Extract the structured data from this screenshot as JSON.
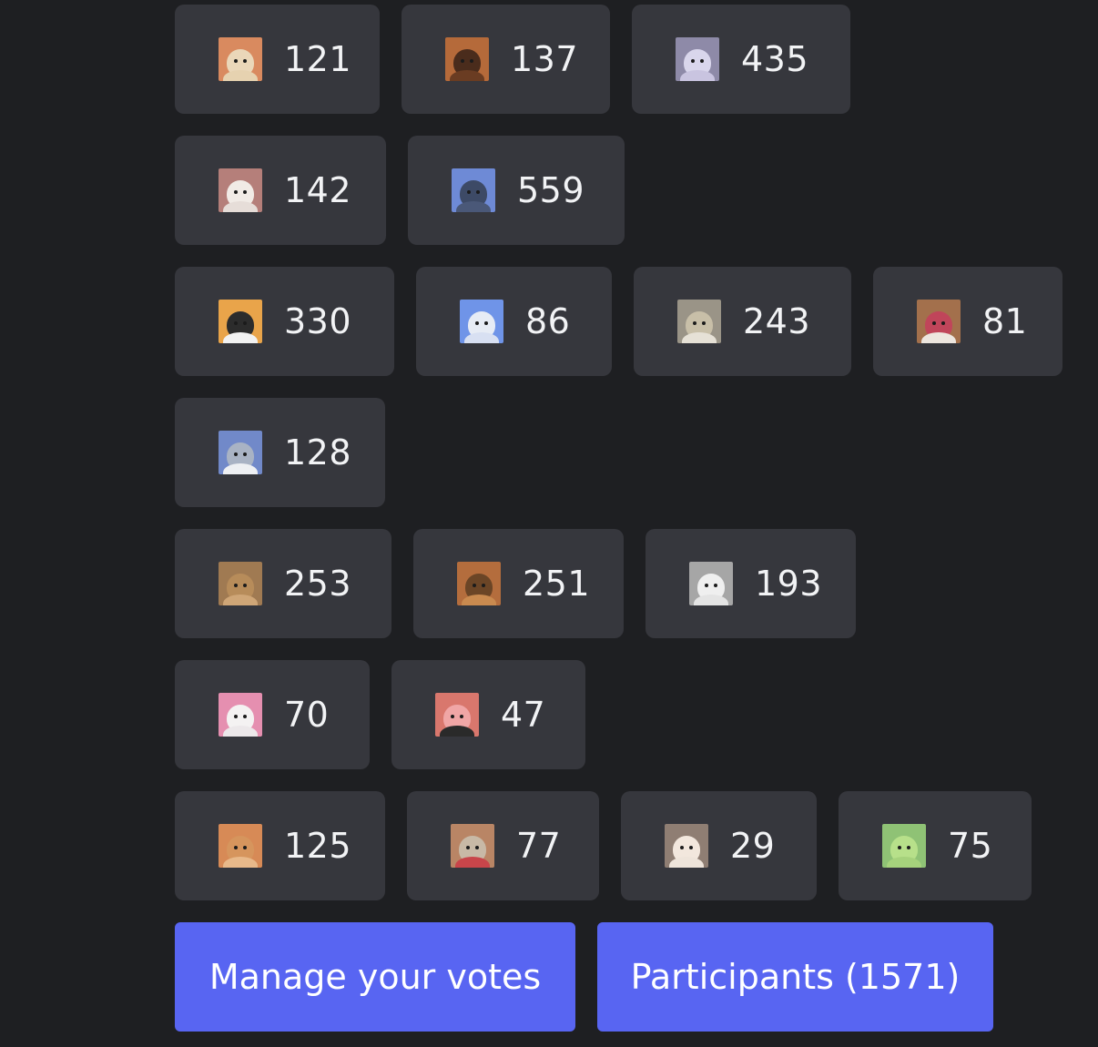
{
  "poll": {
    "answers": [
      {
        "icon": "french-bulldog-avatar-icon",
        "votes": "121",
        "bg": "#d98a5f",
        "head": "#ead7b9",
        "body": "#e6d2b0"
      },
      {
        "icon": "rottweiler-avatar-icon",
        "votes": "137",
        "bg": "#b56a3a",
        "head": "#4a2c1c",
        "body": "#6a3c22"
      },
      {
        "icon": "dolphin-avatar-icon",
        "votes": "435",
        "bg": "#8e8aa8",
        "head": "#d9d6ec",
        "body": "#c9c4e0"
      },
      {
        "icon": "alpaca-avatar-icon",
        "votes": "142",
        "bg": "#b57f7a",
        "head": "#f1ebe6",
        "body": "#e6ddd8"
      },
      {
        "icon": "pigeon-avatar-icon",
        "votes": "559",
        "bg": "#6e8ad6",
        "head": "#3d4a66",
        "body": "#4a5878"
      },
      {
        "icon": "penguin-avatar-icon",
        "votes": "330",
        "bg": "#e9a44a",
        "head": "#2c2c2c",
        "body": "#f2f2f2"
      },
      {
        "icon": "cool-duck-avatar-icon",
        "votes": "86",
        "bg": "#6f94e8",
        "head": "#e7ecf5",
        "body": "#d8e0f2"
      },
      {
        "icon": "tabby-cat-avatar-icon",
        "votes": "243",
        "bg": "#9a9487",
        "head": "#c8bfa8",
        "body": "#e6e1d6"
      },
      {
        "icon": "pink-seal-avatar-icon",
        "votes": "81",
        "bg": "#a3704c",
        "head": "#c0455a",
        "body": "#ede6df"
      },
      {
        "icon": "koala-avatar-icon",
        "votes": "128",
        "bg": "#7189c9",
        "head": "#a9b3c4",
        "body": "#eef0f3"
      },
      {
        "icon": "capybara-avatar-icon",
        "votes": "253",
        "bg": "#a07a52",
        "head": "#b78c5a",
        "body": "#cfa677"
      },
      {
        "icon": "german-shepherd-avatar-icon",
        "votes": "251",
        "bg": "#b46d3d",
        "head": "#6b4526",
        "body": "#c98a4f"
      },
      {
        "icon": "white-cat-avatar-icon",
        "votes": "193",
        "bg": "#a6a6a6",
        "head": "#efefef",
        "body": "#e4e4e4"
      },
      {
        "icon": "unicorn-avatar-icon",
        "votes": "70",
        "bg": "#e58fb0",
        "head": "#f4f2f2",
        "body": "#ece8ea"
      },
      {
        "icon": "pig-avatar-icon",
        "votes": "47",
        "bg": "#d9776d",
        "head": "#f0a6a6",
        "body": "#2a2a2a"
      },
      {
        "icon": "hamster-avatar-icon",
        "votes": "125",
        "bg": "#d78a56",
        "head": "#d6955d",
        "body": "#e8b98a"
      },
      {
        "icon": "moose-avatar-icon",
        "votes": "77",
        "bg": "#b98565",
        "head": "#c8b9a6",
        "body": "#c8454a"
      },
      {
        "icon": "bulldog-avatar-icon",
        "votes": "29",
        "bg": "#8f7e73",
        "head": "#f2e7dd",
        "body": "#eee4da"
      },
      {
        "icon": "dinosaur-avatar-icon",
        "votes": "75",
        "bg": "#8fc275",
        "head": "#b7e08a",
        "body": "#a6d27c"
      }
    ]
  },
  "actions": {
    "manage_votes": "Manage your votes",
    "participants": "Participants (1571)"
  }
}
